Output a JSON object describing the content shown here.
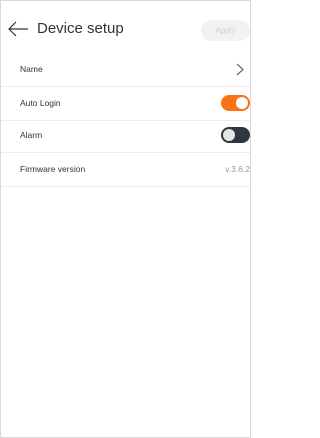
{
  "header": {
    "title": "Device setup",
    "apply_label": "Apply"
  },
  "settings": {
    "name": {
      "label": "Name"
    },
    "auto_login": {
      "label": "Auto Login",
      "enabled": true
    },
    "alarm": {
      "label": "Alarm",
      "enabled": false
    },
    "firmware": {
      "label": "Firmware version",
      "value": "v.3.6.2"
    }
  },
  "colors": {
    "toggle_on": "#f97316",
    "toggle_off": "#2f3640",
    "apply_bg": "#f2f2f2",
    "apply_text": "#d0d0d0",
    "text": "#333333",
    "muted_text": "#999999",
    "divider": "#ececec"
  },
  "icons": {
    "back": "arrow-left-icon",
    "chevron": "chevron-right-icon"
  }
}
